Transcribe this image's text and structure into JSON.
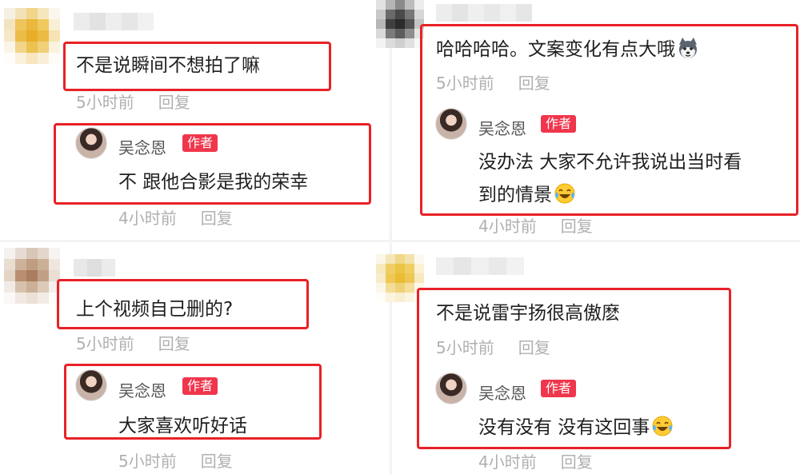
{
  "colors": {
    "box_border": "#e82127",
    "badge_bg": "#f0364c",
    "meta_text": "#b0b0b0"
  },
  "threads": [
    {
      "comment": "不是说瞬间不想拍了嘛",
      "comment_time": "5小时前",
      "comment_reply": "回复",
      "author_name": "吴念恩",
      "author_badge": "作者",
      "reply_lines": [
        "不 跟他合影是我的荣幸"
      ],
      "reply_time": "4小时前",
      "reply_reply": "回复"
    },
    {
      "comment": "哈哈哈哈。文案变化有点大哦",
      "comment_emoji": "husky-dog-emoji",
      "comment_time": "5小时前",
      "comment_reply": "回复",
      "author_name": "吴念恩",
      "author_badge": "作者",
      "reply_lines": [
        "没办法 大家不允许我说出当时看",
        "到的情景"
      ],
      "reply_emoji": "laughing-tears-emoji",
      "reply_time": "4小时前",
      "reply_reply": "回复"
    },
    {
      "comment": "上个视频自己删的?",
      "comment_time": "5小时前",
      "comment_reply": "回复",
      "author_name": "吴念恩",
      "author_badge": "作者",
      "reply_lines": [
        "大家喜欢听好话"
      ],
      "reply_time": "5小时前",
      "reply_reply": "回复"
    },
    {
      "comment": "不是说雷宇扬很高傲麽",
      "comment_time": "5小时前",
      "comment_reply": "回复",
      "author_name": "吴念恩",
      "author_badge": "作者",
      "reply_lines": [
        "没有没有 没有这回事"
      ],
      "reply_emoji": "laughing-tears-emoji",
      "reply_time": "4小时前",
      "reply_reply": "回复"
    }
  ]
}
